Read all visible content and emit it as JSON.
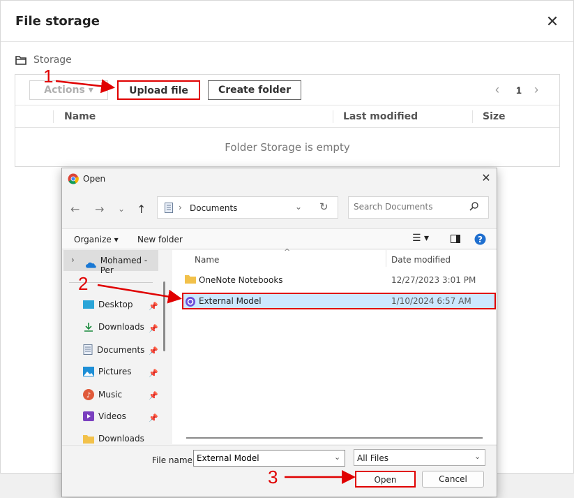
{
  "modal": {
    "title": "File storage",
    "breadcrumb": "Storage",
    "toolbar": {
      "actions_label": "Actions",
      "upload_label": "Upload file",
      "create_folder_label": "Create folder"
    },
    "pager": {
      "prev": "‹",
      "page": "1",
      "next": "›"
    },
    "columns": {
      "name": "Name",
      "last_modified": "Last modified",
      "size": "Size"
    },
    "empty_message": "Folder Storage is empty"
  },
  "dialog": {
    "title": "Open",
    "address": "Documents",
    "search_placeholder": "Search Documents",
    "cmdbar": {
      "organize": "Organize",
      "new_folder": "New folder"
    },
    "nav_top": "Mohamed - Per",
    "nav_items": [
      {
        "label": "Desktop",
        "icon": "desktop-icon"
      },
      {
        "label": "Downloads",
        "icon": "download-icon"
      },
      {
        "label": "Documents",
        "icon": "document-icon"
      },
      {
        "label": "Pictures",
        "icon": "picture-icon"
      },
      {
        "label": "Music",
        "icon": "music-icon"
      },
      {
        "label": "Videos",
        "icon": "video-icon"
      },
      {
        "label": "Downloads",
        "icon": "folder-icon"
      }
    ],
    "file_columns": {
      "name": "Name",
      "date": "Date modified"
    },
    "files": [
      {
        "name": "OneNote Notebooks",
        "date": "12/27/2023 3:01 PM",
        "icon": "folder-icon"
      },
      {
        "name": "External Model",
        "date": "1/10/2024 6:57 AM",
        "icon": "model-file-icon"
      }
    ],
    "file_name_label": "File name:",
    "file_name_value": "External Model",
    "file_type": "All Files",
    "open_label": "Open",
    "cancel_label": "Cancel"
  },
  "annotations": {
    "step1": "1",
    "step2": "2",
    "step3": "3",
    "color": "#e00000"
  }
}
